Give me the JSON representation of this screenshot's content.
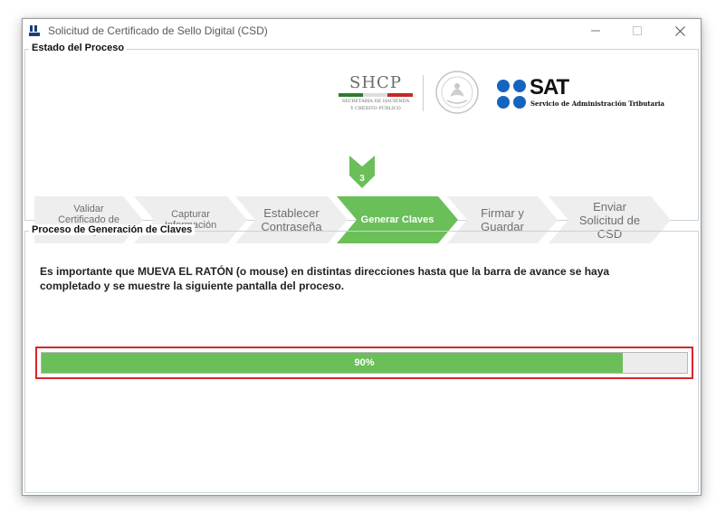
{
  "window": {
    "title": "Solicitud de Certificado de Sello Digital (CSD)",
    "app_icon": "sat-app-icon",
    "controls": {
      "minimize_icon": "minimize-icon",
      "maximize_icon": "maximize-icon",
      "close_icon": "close-icon"
    }
  },
  "process_status": {
    "title": "Estado del Proceso",
    "logos": {
      "shcp_title": "SHCP",
      "shcp_subtitle_line1": "SECRETARÍA DE HACIENDA",
      "shcp_subtitle_line2": "Y CRÉDITO PÚBLICO",
      "sat_title": "SAT",
      "sat_subtitle": "Servicio de Administración Tributaria"
    },
    "current_step_number": "3",
    "steps": [
      {
        "label": "Validar Certificado de FIEL Vigente",
        "active": false
      },
      {
        "label": "Capturar Información",
        "active": false
      },
      {
        "label": "Establecer Contraseña",
        "active": false
      },
      {
        "label": "Generar Claves",
        "active": true
      },
      {
        "label": "Firmar y Guardar",
        "active": false
      },
      {
        "label": "Enviar Solicitud de CSD",
        "active": false
      }
    ]
  },
  "key_generation": {
    "title": "Proceso de Generación de Claves",
    "instructions_line1": "Es importante que MUEVA EL RATÓN (o mouse) en distintas direcciones hasta que la barra de avance se haya",
    "instructions_line2": "completado y se muestre la siguiente pantalla del proceso.",
    "progress_value": 0.9,
    "progress_label": "90%"
  },
  "colors": {
    "accent_green": "#6abf59",
    "highlight_red": "#d9242b",
    "sat_blue": "#1565c0",
    "inactive_step": "#eeeeee"
  }
}
